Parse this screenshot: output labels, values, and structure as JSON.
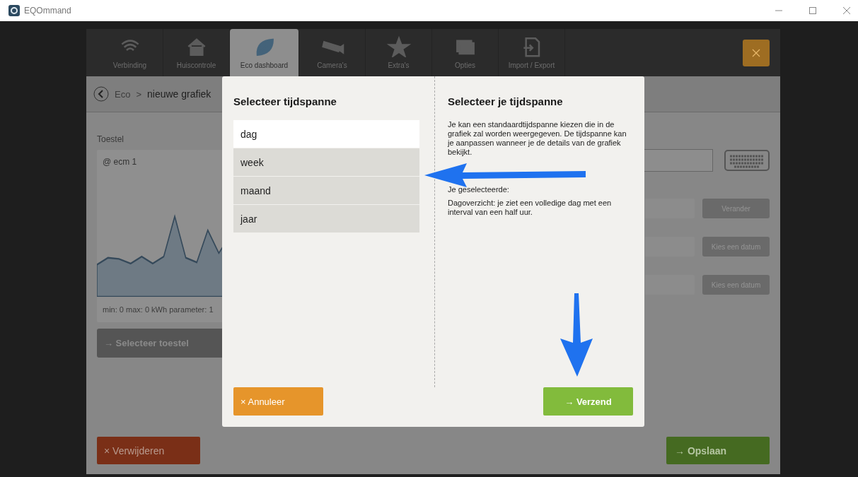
{
  "window": {
    "title": "EQOmmand"
  },
  "tabs": [
    {
      "label": "Verbinding",
      "selected": false
    },
    {
      "label": "Huiscontrole",
      "selected": false
    },
    {
      "label": "Eco dashboard",
      "selected": true
    },
    {
      "label": "Camera's",
      "selected": false
    },
    {
      "label": "Extra's",
      "selected": false
    },
    {
      "label": "Opties",
      "selected": false
    },
    {
      "label": "Import / Export",
      "selected": false
    }
  ],
  "breadcrumb": {
    "parent": "Eco",
    "separator": ">",
    "current": "nieuwe grafiek"
  },
  "device": {
    "label": "Toestel",
    "name": "@ ecm 1",
    "summary": "min: 0 max: 0 kWh parameter: 1",
    "button": "→ Selecteer toestel"
  },
  "side_buttons": [
    "Verander",
    "Kies een datum",
    "Kies een datum"
  ],
  "footer": {
    "delete": "× Verwijderen",
    "save": "→ Opslaan"
  },
  "dialog": {
    "title": "Selecteer tijdspanne",
    "options": [
      {
        "label": "dag",
        "selected": true
      },
      {
        "label": "week",
        "selected": false
      },
      {
        "label": "maand",
        "selected": false
      },
      {
        "label": "jaar",
        "selected": false
      }
    ],
    "help_title": "Selecteer je tijdspanne",
    "help_paragraphs": [
      "Je kan een standaardtijdspanne kiezen die in de grafiek zal worden weergegeven. De tijdspanne kan je aanpassen wanneer je de details van de grafiek bekijkt.",
      "Je geselecteerde:",
      "Dagoverzicht: je ziet een volledige dag met een interval van een half uur."
    ],
    "cancel": "× Annuleer",
    "submit": "→ Verzend"
  }
}
